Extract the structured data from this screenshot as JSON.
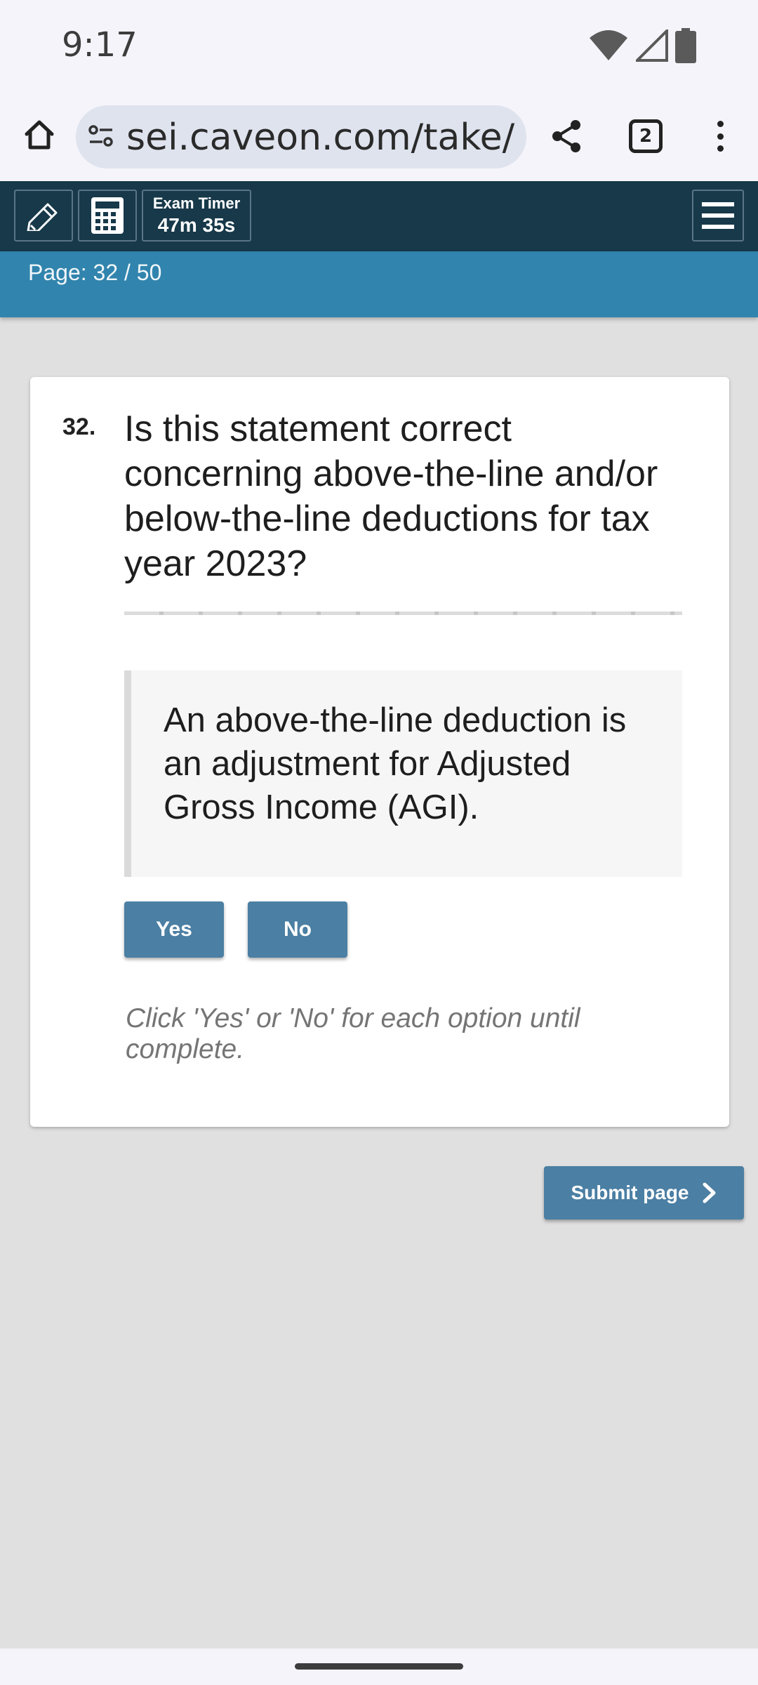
{
  "status_bar": {
    "time": "9:17",
    "icons": [
      "wifi-icon",
      "signal-icon",
      "battery-icon"
    ]
  },
  "browser": {
    "url": "sei.caveon.com/take/",
    "tab_count": "2",
    "icons": [
      "home-icon",
      "tune-icon",
      "share-icon",
      "tabs-icon",
      "more-vert-icon"
    ]
  },
  "toolbar": {
    "timer_label": "Exam Timer",
    "timer_value": "47m 35s",
    "icons": [
      "pencil-icon",
      "calculator-icon",
      "hamburger-menu-icon"
    ]
  },
  "page_bar": {
    "label": "Page: 32 / 50"
  },
  "question": {
    "number": "32.",
    "text": "Is this statement correct concerning above-the-line and/or below-the-line deductions for tax year 2023?",
    "statement": "An above-the-line deduction is an adjustment for Adjusted Gross Income (AGI).",
    "yes_label": "Yes",
    "no_label": "No",
    "instruction": "Click 'Yes' or 'No' for each option until complete."
  },
  "submit": {
    "label": "Submit page",
    "icon": "chevron-right-icon"
  },
  "colors": {
    "toolbar": "#17394a",
    "page_bar": "#3184ad",
    "button": "#4b7fa3",
    "background": "#e0e0e0"
  }
}
